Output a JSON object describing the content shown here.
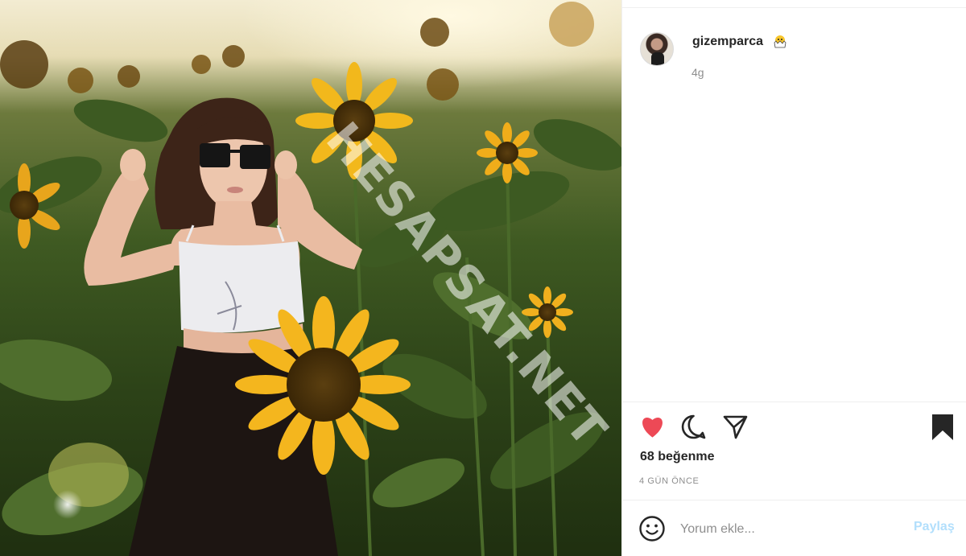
{
  "post": {
    "username": "gizemparca",
    "user_badge_icon": "hatching-chick-icon",
    "user_meta": "4g",
    "watermark": "HESAPSAT.NET",
    "likes_text": "68 beğenme",
    "time_text": "4 GÜN ÖNCE"
  },
  "actions": {
    "like_icon": "heart-icon",
    "comment_icon": "comment-icon",
    "share_icon": "paper-plane-icon",
    "save_icon": "bookmark-icon",
    "liked": true,
    "saved": true
  },
  "comment_box": {
    "emoji_icon": "smiley-icon",
    "placeholder": "Yorum ekle...",
    "post_label": "Paylaş"
  },
  "colors": {
    "like_red": "#ed4956",
    "text_dark": "#262626",
    "text_muted": "#8e8e8e",
    "post_button_disabled": "#b2dffc",
    "border": "#efefef"
  }
}
